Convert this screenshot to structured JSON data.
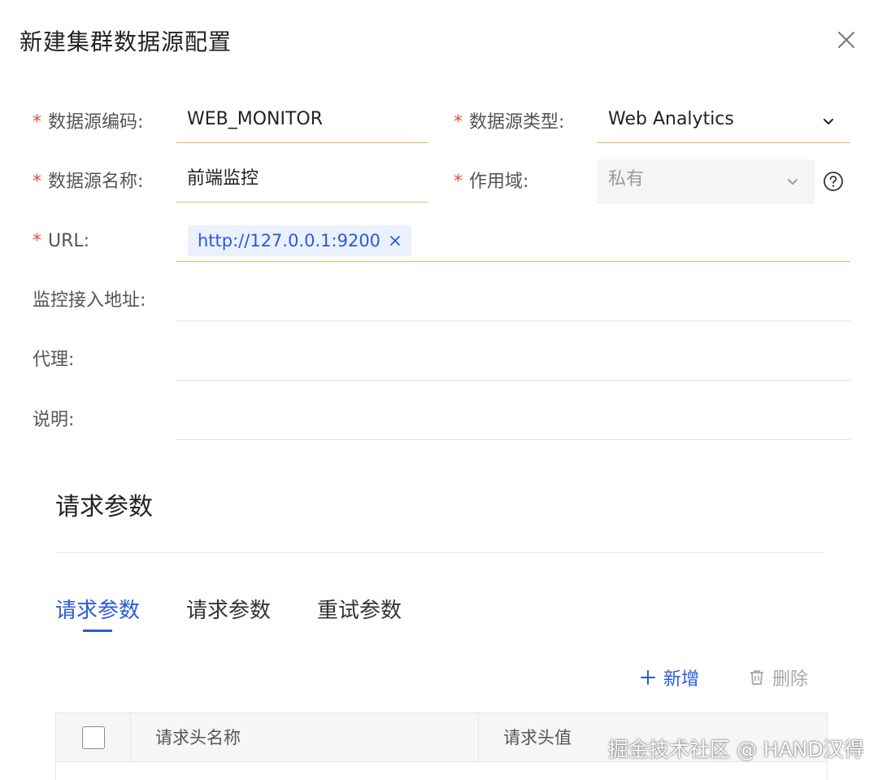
{
  "dialog": {
    "title": "新建集群数据源配置"
  },
  "form": {
    "required_mark": "*",
    "source_code": {
      "label": "数据源编码:",
      "value": "WEB_MONITOR"
    },
    "source_type": {
      "label": "数据源类型:",
      "value": "Web Analytics"
    },
    "source_name": {
      "label": "数据源名称:",
      "value": "前端监控"
    },
    "scope": {
      "label": "作用域:",
      "value": "私有"
    },
    "url": {
      "label": "URL:",
      "tags": [
        "http://127.0.0.1:9200"
      ]
    },
    "monitor_address": {
      "label": "监控接入地址:",
      "value": ""
    },
    "proxy": {
      "label": "代理:",
      "value": ""
    },
    "description": {
      "label": "说明:",
      "value": ""
    }
  },
  "request_section": {
    "title": "请求参数",
    "tabs": [
      {
        "label": "请求参数",
        "active": true
      },
      {
        "label": "请求参数",
        "active": false
      },
      {
        "label": "重试参数",
        "active": false
      }
    ],
    "actions": {
      "add": "新增",
      "delete": "删除"
    },
    "table": {
      "columns": [
        "请求头名称",
        "请求头值"
      ]
    }
  },
  "watermark": "掘金技术社区 @ HAND汉得",
  "colors": {
    "primary": "#2a5bd7",
    "required": "#e84c3d",
    "required_underline": "#f0b46a",
    "disabled_bg": "#f4f5f7"
  },
  "icons": {
    "close": "close-icon",
    "dropdown": "chevron-down-icon",
    "help": "help-circle-icon",
    "tag_remove": "close-icon",
    "add": "plus-icon",
    "delete": "trash-icon"
  }
}
